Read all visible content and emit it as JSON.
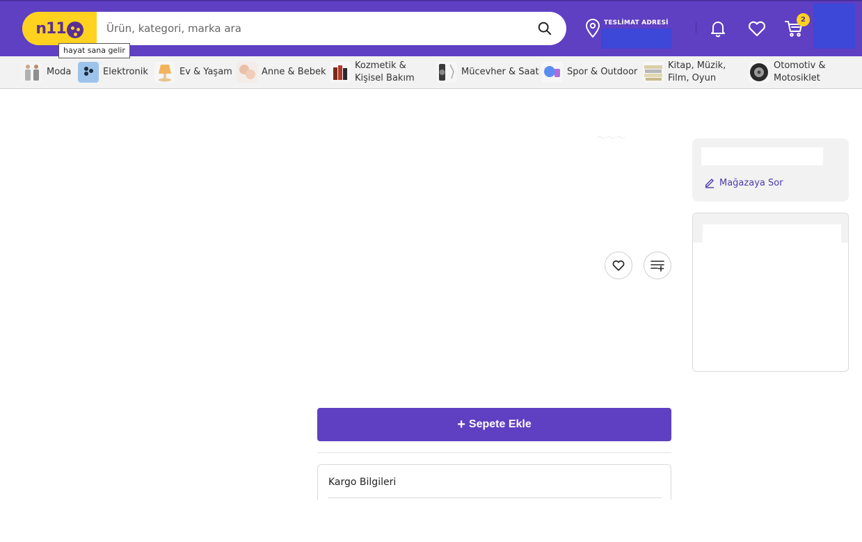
{
  "header": {
    "logo_text": "n11",
    "tooltip": "hayat sana gelir",
    "search": {
      "placeholder": "Ürün, kategori, marka ara"
    },
    "address": {
      "label": "TESLİMAT ADRESİ",
      "value": ""
    },
    "cart_count": "2"
  },
  "categories": [
    {
      "label": "Moda"
    },
    {
      "label": "Elektronik"
    },
    {
      "label": "Ev & Yaşam"
    },
    {
      "label": "Anne & Bebek"
    },
    {
      "label": "Kozmetik &\nKişisel Bakım"
    },
    {
      "label": "Mücevher & Saat"
    },
    {
      "label": "Spor & Outdoor"
    },
    {
      "label": "Kitap, Müzik,\nFilm, Oyun"
    },
    {
      "label": "Otomotiv &\nMotosiklet"
    }
  ],
  "store": {
    "name": "",
    "ask_label": "Mağazaya Sor"
  },
  "product": {
    "add_to_cart_label": "Sepete Ekle"
  },
  "cargo": {
    "title": "Kargo Bilgileri"
  },
  "colors": {
    "brand_purple": "#5f3fc2",
    "brand_yellow": "#ffd21f",
    "placeholder_blue": "#3d47d8"
  }
}
